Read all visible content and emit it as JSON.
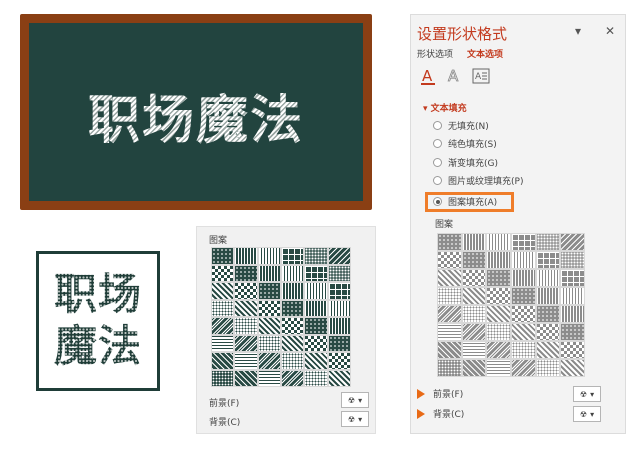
{
  "board": {
    "title": "职场魔法"
  },
  "stamp": {
    "line1": "职场",
    "line2": "魔法"
  },
  "pattern_grid_mid": {
    "label": "图案",
    "foreground_label": "前景(F)",
    "background_label": "背景(C)",
    "foreground_color": "#294a44",
    "background_color": "#ffffff"
  },
  "pane": {
    "title": "设置形状格式",
    "dropdown_icon": "chevron-down-icon",
    "close_icon": "close-icon",
    "tabs": [
      "形状选项",
      "文本选项"
    ],
    "active_tab": "文本选项",
    "icons": [
      "text-fill-outline-icon",
      "text-effects-icon",
      "textbox-icon"
    ],
    "section_title": "文本填充",
    "fill_options": [
      {
        "label": "无填充(N)",
        "selected": false
      },
      {
        "label": "纯色填充(S)",
        "selected": false
      },
      {
        "label": "渐变填充(G)",
        "selected": false
      },
      {
        "label": "图片或纹理填充(P)",
        "selected": false
      },
      {
        "label": "图案填充(A)",
        "selected": true
      }
    ],
    "pattern_label": "图案",
    "foreground_label": "前景(F)",
    "background_label": "背景(C)",
    "accent_color": "#c33a1e",
    "highlight_color": "#ef7d2a"
  }
}
